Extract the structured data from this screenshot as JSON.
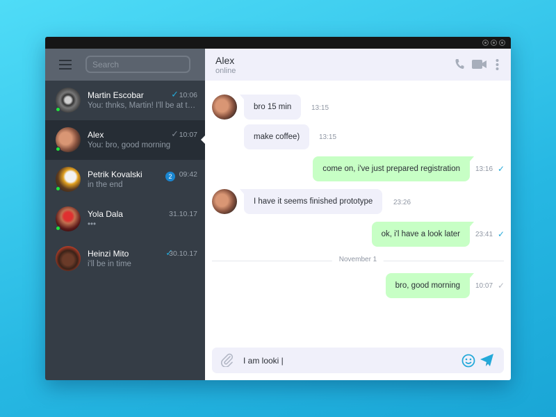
{
  "window": {
    "controls": [
      "minimize",
      "maximize",
      "close"
    ]
  },
  "sidebar": {
    "menu_icon": "hamburger-icon",
    "search_placeholder": "Search",
    "contacts": [
      {
        "name": "Martin Escobar",
        "preview": "You: thnks, Martin! I'll be at there",
        "time": "10:06",
        "check": "read",
        "online": true
      },
      {
        "name": "Alex",
        "preview": "You: bro, good morning",
        "time": "10:07",
        "check": "sent",
        "online": true,
        "active": true
      },
      {
        "name": "Petrik Kovalski",
        "preview": "in the end",
        "time": "09:42",
        "unread": "2",
        "online": true
      },
      {
        "name": "Yola Dala",
        "preview": "•••",
        "time": "31.10.17",
        "online": true
      },
      {
        "name": "Heinzi Mito",
        "preview": "i'll be in time",
        "time": "30.10.17",
        "check": "read",
        "online": false
      }
    ]
  },
  "chat": {
    "name": "Alex",
    "status": "online",
    "header_icons": [
      "phone-icon",
      "video-camera-icon",
      "more-vertical-icon"
    ],
    "messages": [
      {
        "dir": "in",
        "text": "bro 15 min",
        "time": "13:15"
      },
      {
        "dir": "in",
        "text": "make coffee)",
        "time": "13:15"
      },
      {
        "dir": "out",
        "text": "come on, i've just prepared registration",
        "time": "13:16",
        "check": "read"
      },
      {
        "dir": "in",
        "text": "I have it seems finished prototype",
        "time": "23:26"
      },
      {
        "dir": "out",
        "text": "ok, i'l have a look later",
        "time": "23:41",
        "check": "read"
      },
      {
        "dir": "out",
        "text": "bro, good morning",
        "time": "10:07",
        "check": "sent"
      }
    ],
    "date_divider": "November 1",
    "composer": {
      "value": "I am looki |",
      "icons": [
        "paperclip-icon",
        "emoji-icon",
        "send-icon"
      ]
    }
  },
  "colors": {
    "accent": "#24a9d9",
    "sent_bubble": "#c7ffc5",
    "received_bubble": "#f0f0fa",
    "online": "#22e33c",
    "badge": "#1a86d0"
  }
}
